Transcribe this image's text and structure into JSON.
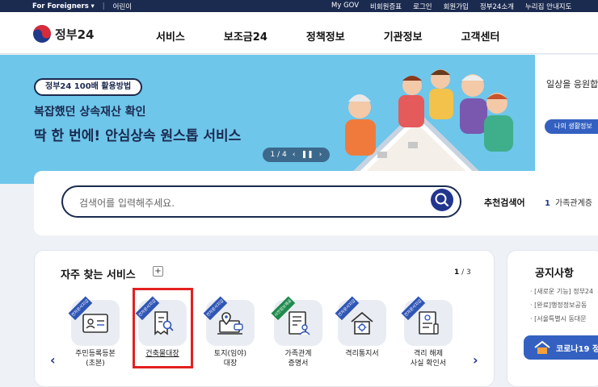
{
  "topbar": {
    "for_foreigners": "For Foreigners",
    "kids": "어린이",
    "links": [
      "My GOV",
      "비회원증표",
      "로그인",
      "회원가입",
      "정부24소개",
      "누리집 안내지도"
    ]
  },
  "header": {
    "logo_text": "정부24",
    "menu": [
      "서비스",
      "보조금24",
      "정책정보",
      "기관정보",
      "고객센터"
    ]
  },
  "hero": {
    "pill": "정부24 100배 활용방법",
    "line1": "복잡했던 상속재산 확인",
    "line2": "딱 한 번에! 안심상속 원스톱 서비스",
    "pager": "1 / 4",
    "side_text": "일상을 응원합",
    "side_button": "나의 생활정보"
  },
  "search": {
    "placeholder": "검색어를 입력해주세요.",
    "recommend_label": "추천검색어",
    "recommend_rank": "1",
    "recommend_item": "가족관계증"
  },
  "services": {
    "title": "자주 찾는 서비스",
    "page_current": "1",
    "page_total": "/ 3",
    "items": [
      {
        "label": "주민등록등본\n(초본)",
        "ribbon": "전자문서지갑",
        "ribbon_color": "#2f55b5"
      },
      {
        "label": "건축물대장",
        "ribbon": "전자문서지갑",
        "ribbon_color": "#2f55b5"
      },
      {
        "label": "토지(임야)\n대장",
        "ribbon": "전자문서지갑",
        "ribbon_color": "#2f55b5"
      },
      {
        "label": "가족관계\n증명서",
        "ribbon": "사전정보제공",
        "ribbon_color": "#1e8a4c"
      },
      {
        "label": "격리통지서",
        "ribbon": "전자문서지갑",
        "ribbon_color": "#2f55b5"
      },
      {
        "label": "격리 해제\n사실 확인서",
        "ribbon": "전자문서지갑",
        "ribbon_color": "#2f55b5"
      }
    ]
  },
  "notice": {
    "title": "공지사항",
    "lines": [
      "· [새로운 기능] 정부24",
      "· [완료]행정정보공동",
      "· [서울특별시 동대문"
    ],
    "corona": "코로나19 정"
  }
}
